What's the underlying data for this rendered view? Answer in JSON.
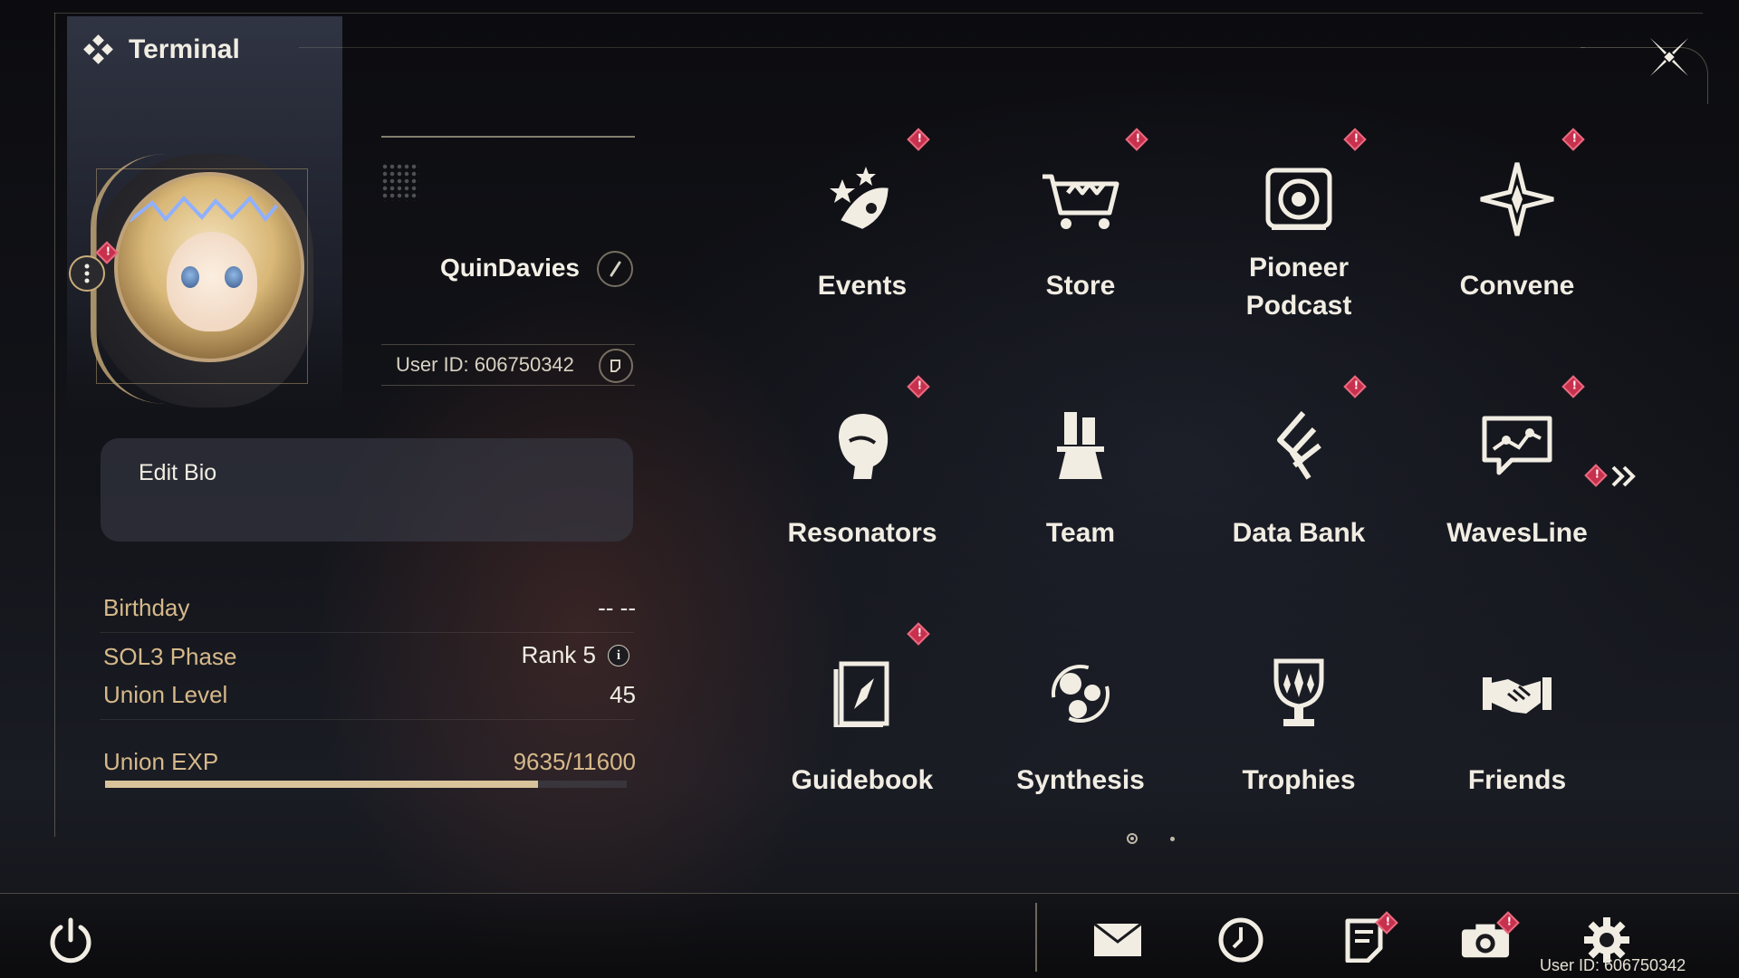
{
  "header": {
    "title": "Terminal"
  },
  "profile": {
    "username": "QuinDavies",
    "user_id": "User ID: 606750342",
    "bio_label": "Edit Bio"
  },
  "stats": {
    "birthday_label": "Birthday",
    "birthday_value": "-- --",
    "sol3_label": "SOL3 Phase",
    "sol3_value": "Rank 5",
    "union_level_label": "Union Level",
    "union_level_value": "45",
    "union_exp_label": "Union EXP",
    "union_exp_value": "9635/11600",
    "union_exp_progress": 0.83
  },
  "menu": [
    {
      "label": "Events",
      "icon": "events-icon",
      "alert": true
    },
    {
      "label": "Store",
      "icon": "store-cart-icon",
      "alert": true
    },
    {
      "label": "Pioneer\nPodcast",
      "icon": "podcast-speaker-icon",
      "alert": true
    },
    {
      "label": "Convene",
      "icon": "convene-star-icon",
      "alert": true
    },
    {
      "label": "Resonators",
      "icon": "resonator-head-icon",
      "alert": true
    },
    {
      "label": "Team",
      "icon": "team-chess-icon",
      "alert": false
    },
    {
      "label": "Data Bank",
      "icon": "data-bank-icon",
      "alert": true
    },
    {
      "label": "WavesLine",
      "icon": "wavesline-chat-icon",
      "alert": true
    },
    {
      "label": "Guidebook",
      "icon": "guidebook-compass-icon",
      "alert": true
    },
    {
      "label": "Synthesis",
      "icon": "synthesis-orbs-icon",
      "alert": false
    },
    {
      "label": "Trophies",
      "icon": "trophy-icon",
      "alert": false
    },
    {
      "label": "Friends",
      "icon": "friends-handshake-icon",
      "alert": false
    }
  ],
  "pagination": {
    "current_page": 1,
    "total_pages": 2
  },
  "footer": {
    "user_id": "User ID: 606750342",
    "icons": [
      "mail-icon",
      "clock-icon",
      "notice-icon",
      "camera-icon",
      "settings-gear-icon"
    ]
  },
  "colors": {
    "accent_gold": "#d6b98a",
    "alert_red": "#c7314d",
    "text": "#f1ede3"
  }
}
